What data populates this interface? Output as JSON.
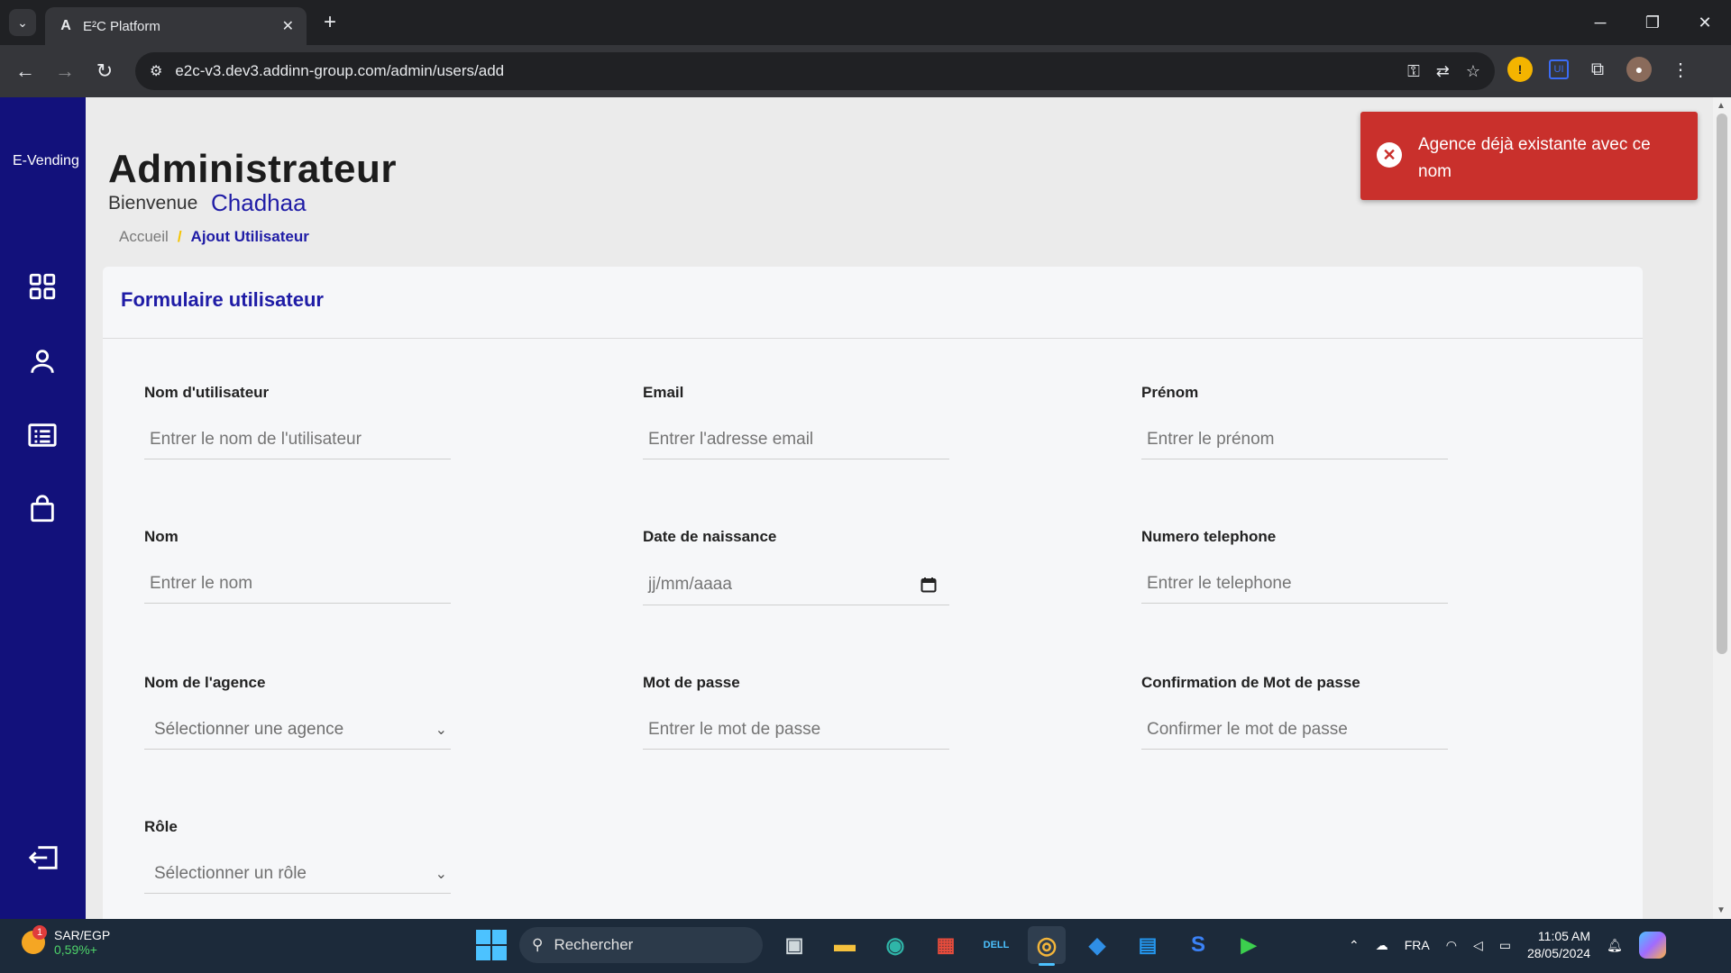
{
  "browser": {
    "tab_title": "E²C Platform",
    "tab_favicon": "A",
    "url": "e2c-v3.dev3.addinn-group.com/admin/users/add"
  },
  "sidebar": {
    "brand": "E-Vending",
    "items": [
      {
        "icon": "dashboard-grid-icon"
      },
      {
        "icon": "user-icon"
      },
      {
        "icon": "list-icon"
      },
      {
        "icon": "shopping-bag-icon"
      },
      {
        "icon": "logout-icon"
      }
    ]
  },
  "header": {
    "title": "Administrateur",
    "welcome": "Bienvenue",
    "user_name": "Chadhaa",
    "breadcrumb": {
      "home": "Accueil",
      "separator": "/",
      "current": "Ajout Utilisateur"
    }
  },
  "form": {
    "title": "Formulaire utilisateur",
    "fields": {
      "username": {
        "label": "Nom d'utilisateur",
        "placeholder": "Entrer le nom de l'utilisateur"
      },
      "email": {
        "label": "Email",
        "placeholder": "Entrer l'adresse email"
      },
      "firstname": {
        "label": "Prénom",
        "placeholder": "Entrer le prénom"
      },
      "lastname": {
        "label": "Nom",
        "placeholder": "Entrer le nom"
      },
      "birthdate": {
        "label": "Date de naissance",
        "placeholder": "jj/mm/aaaa"
      },
      "phone": {
        "label": "Numero telephone",
        "placeholder": "Entrer le telephone"
      },
      "agency": {
        "label": "Nom de l'agence",
        "selected": "Sélectionner une agence"
      },
      "password": {
        "label": "Mot de passe",
        "placeholder": "Entrer le mot de passe"
      },
      "password_confirm": {
        "label": "Confirmation de Mot de passe",
        "placeholder": "Confirmer le mot de passe"
      },
      "role": {
        "label": "Rôle",
        "selected": "Sélectionner un rôle"
      }
    }
  },
  "toast": {
    "type": "error",
    "message": "Agence déjà existante avec ce nom",
    "color": "#c9302c"
  },
  "taskbar": {
    "weather_label": "SAR/EGP",
    "weather_value": "0,59%+",
    "weather_badge": "1",
    "search_placeholder": "Rechercher",
    "language": "FRA",
    "time": "11:05 AM",
    "date": "28/05/2024"
  },
  "colors": {
    "sidebar_bg": "#12117b",
    "accent": "#1f1ca6",
    "breadcrumb_separator": "#f5c400"
  }
}
